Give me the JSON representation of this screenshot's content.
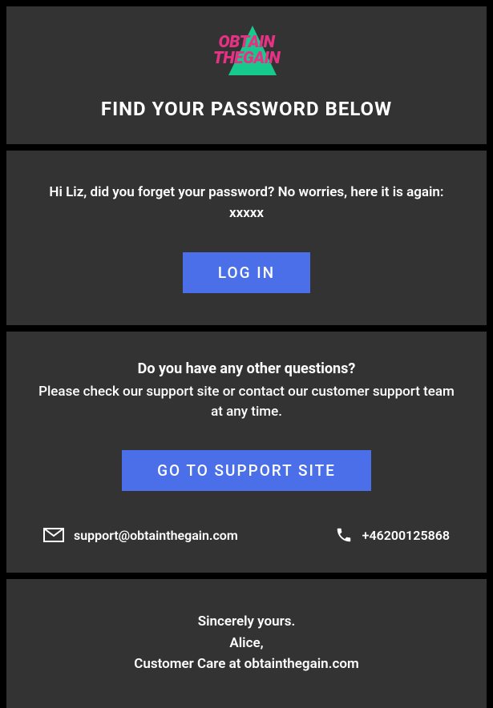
{
  "brand": {
    "line1": "OBTAIN",
    "line2": "THEGAIN"
  },
  "header": {
    "title": "FIND YOUR PASSWORD BELOW"
  },
  "message": {
    "greeting": "Hi Liz, did you forget your password? No worries, here it is again: xxxxx",
    "login_button": "LOG IN"
  },
  "support": {
    "question": "Do you have any other questions?",
    "subtext": "Please check our support site or contact our customer support team at any time.",
    "button": "GO TO SUPPORT SITE",
    "email": "support@obtainthegain.com",
    "phone": "+46200125868"
  },
  "signature": {
    "closing": "Sincerely yours.",
    "name": "Alice,",
    "role": "Customer Care at obtainthegain.com"
  }
}
